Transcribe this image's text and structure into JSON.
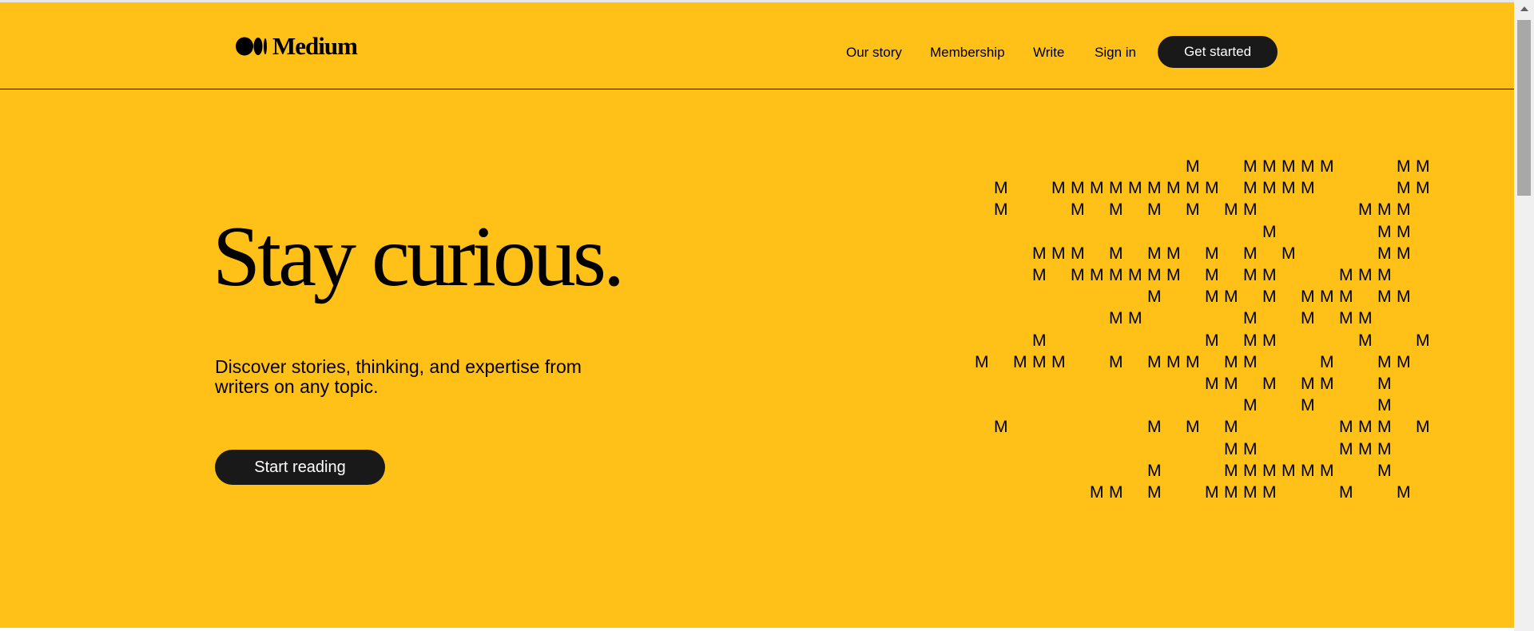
{
  "header": {
    "logo_text": "Medium",
    "nav": [
      "Our story",
      "Membership",
      "Write",
      "Sign in"
    ],
    "cta": "Get started"
  },
  "hero": {
    "title": "Stay curious.",
    "subtitle": "Discover stories, thinking, and expertise from writers on any topic.",
    "button": "Start reading"
  },
  "pattern": {
    "letter": "M",
    "rows": [
      "           M  MMMMM   MM",
      " M  MMMMMMMMM MMMM    MM",
      " M   M M M M MM     MMM ",
      "               M     MM ",
      "   MMM M MM M M M    MM ",
      "   M MMMMMM M MM   MMM  ",
      "         M  MM M MMM MM ",
      "       MM     M  M MM   ",
      "   M        M MM    M  M",
      "M MMM  M MMM MM   M  MM ",
      "            MM M MM  M  ",
      "              M  M   M  ",
      " M       M M M     MMM M",
      "             MM    MMM  ",
      "         M   MMMMMM  M  ",
      "      MM M  MMMM   M  M "
    ]
  },
  "colors": {
    "background": "#FFC017",
    "button": "#191919"
  },
  "icons": {
    "logo": "medium-logo-icon",
    "scroll_up": "arrow-up-icon"
  }
}
